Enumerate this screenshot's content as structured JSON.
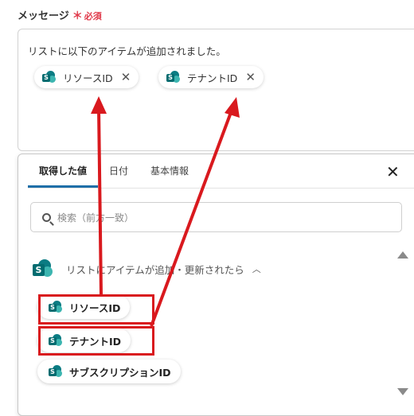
{
  "field": {
    "label": "メッセージ",
    "required_star": "＊",
    "required_text": "必須"
  },
  "message": {
    "text": "リストに以下のアイテムが追加されました。",
    "chips": [
      {
        "label": "リソースID",
        "icon": "sharepoint-icon"
      },
      {
        "label": "テナントID",
        "icon": "sharepoint-icon"
      }
    ]
  },
  "panel": {
    "tabs": [
      "取得した値",
      "日付",
      "基本情報"
    ],
    "active_tab": "取得した値",
    "search_placeholder": "検索（前方一致）",
    "group": {
      "title": "リストにアイテムが追加・更新されたら",
      "expanded": true
    },
    "items": [
      "リソースID",
      "テナントID",
      "サブスクリプションID"
    ]
  },
  "colors": {
    "accent": "#1f6fa8",
    "highlight": "#d9191e",
    "required": "#e0394a",
    "sharepoint": "#0b7c83"
  }
}
